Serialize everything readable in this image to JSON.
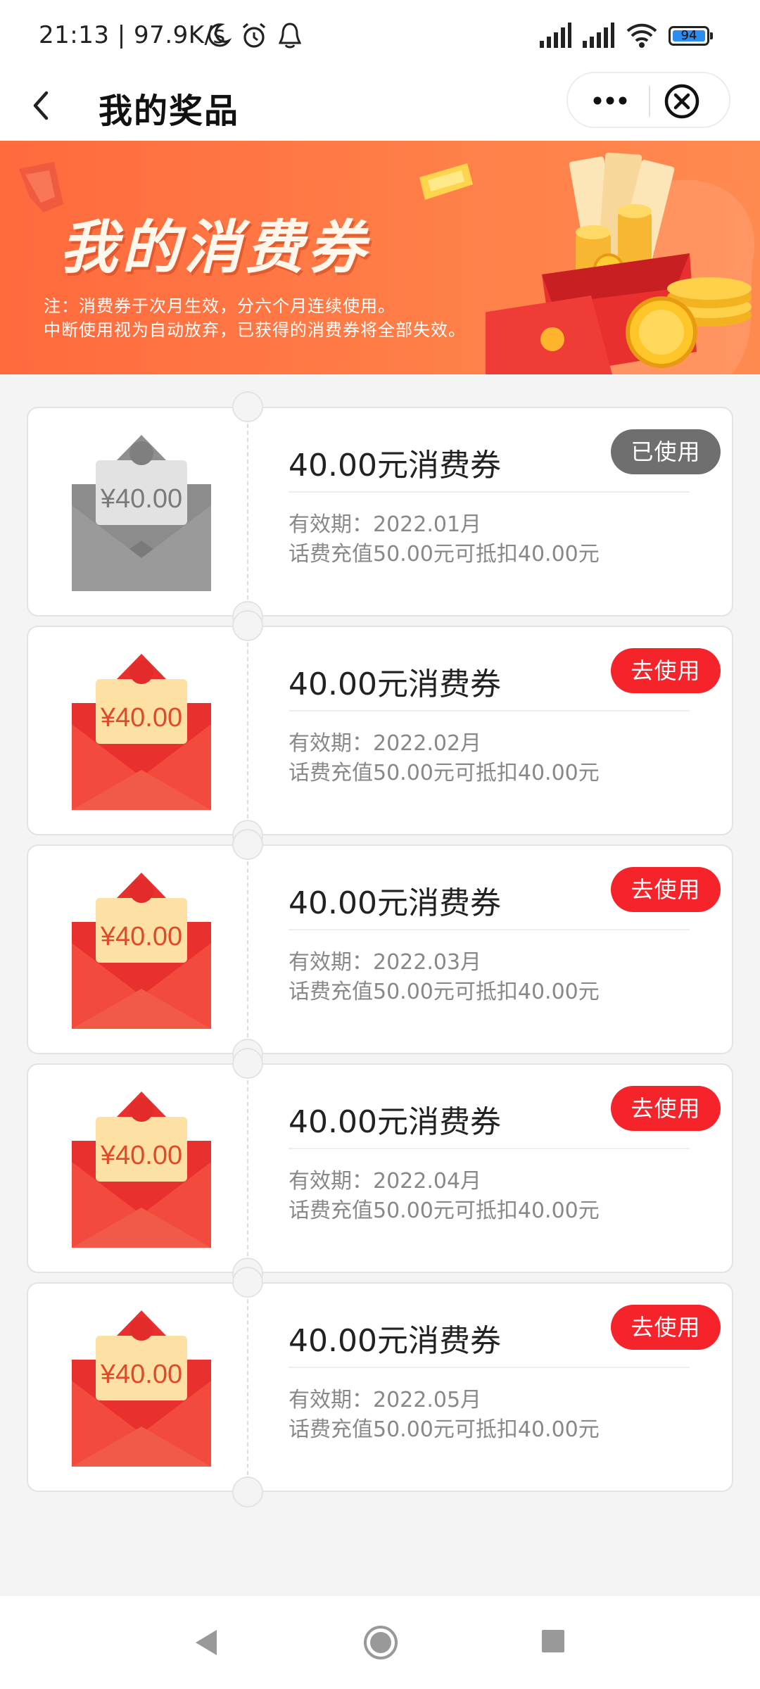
{
  "status_bar": {
    "time_speed": "21:13 | 97.9K/s",
    "battery_level": "94",
    "icons": [
      "moon-icon",
      "alarm-icon",
      "notification-icon",
      "signal-icon",
      "signal-icon",
      "wifi-icon",
      "battery-icon"
    ]
  },
  "header": {
    "title": "我的奖品",
    "back_icon": "chevron-left-icon",
    "more_icon": "more-dots-icon",
    "close_icon": "close-circle-icon"
  },
  "banner": {
    "title": "我的消费券",
    "note_line1": "注：消费券于次月生效，分六个月连续使用。",
    "note_line2": "中断使用视为自动放弃，已获得的消费券将全部失效。",
    "accent_color": "#ff6a3d"
  },
  "coupons": [
    {
      "amount_label": "¥40.00",
      "name": "40.00元消费券",
      "validity": "有效期：2022.01月",
      "desc": "话费充值50.00元可抵扣40.00元",
      "status": "已使用",
      "state": "used",
      "button_color": "#6f6f6f"
    },
    {
      "amount_label": "¥40.00",
      "name": "40.00元消费券",
      "validity": "有效期：2022.02月",
      "desc": "话费充值50.00元可抵扣40.00元",
      "status": "去使用",
      "state": "available",
      "button_color": "#f5242b"
    },
    {
      "amount_label": "¥40.00",
      "name": "40.00元消费券",
      "validity": "有效期：2022.03月",
      "desc": "话费充值50.00元可抵扣40.00元",
      "status": "去使用",
      "state": "available",
      "button_color": "#f5242b"
    },
    {
      "amount_label": "¥40.00",
      "name": "40.00元消费券",
      "validity": "有效期：2022.04月",
      "desc": "话费充值50.00元可抵扣40.00元",
      "status": "去使用",
      "state": "available",
      "button_color": "#f5242b"
    },
    {
      "amount_label": "¥40.00",
      "name": "40.00元消费券",
      "validity": "有效期：2022.05月",
      "desc": "话费充值50.00元可抵扣40.00元",
      "status": "去使用",
      "state": "available",
      "button_color": "#f5242b"
    }
  ],
  "nav_bar": {
    "icons": [
      "nav-back-icon",
      "nav-home-icon",
      "nav-recent-icon"
    ]
  }
}
